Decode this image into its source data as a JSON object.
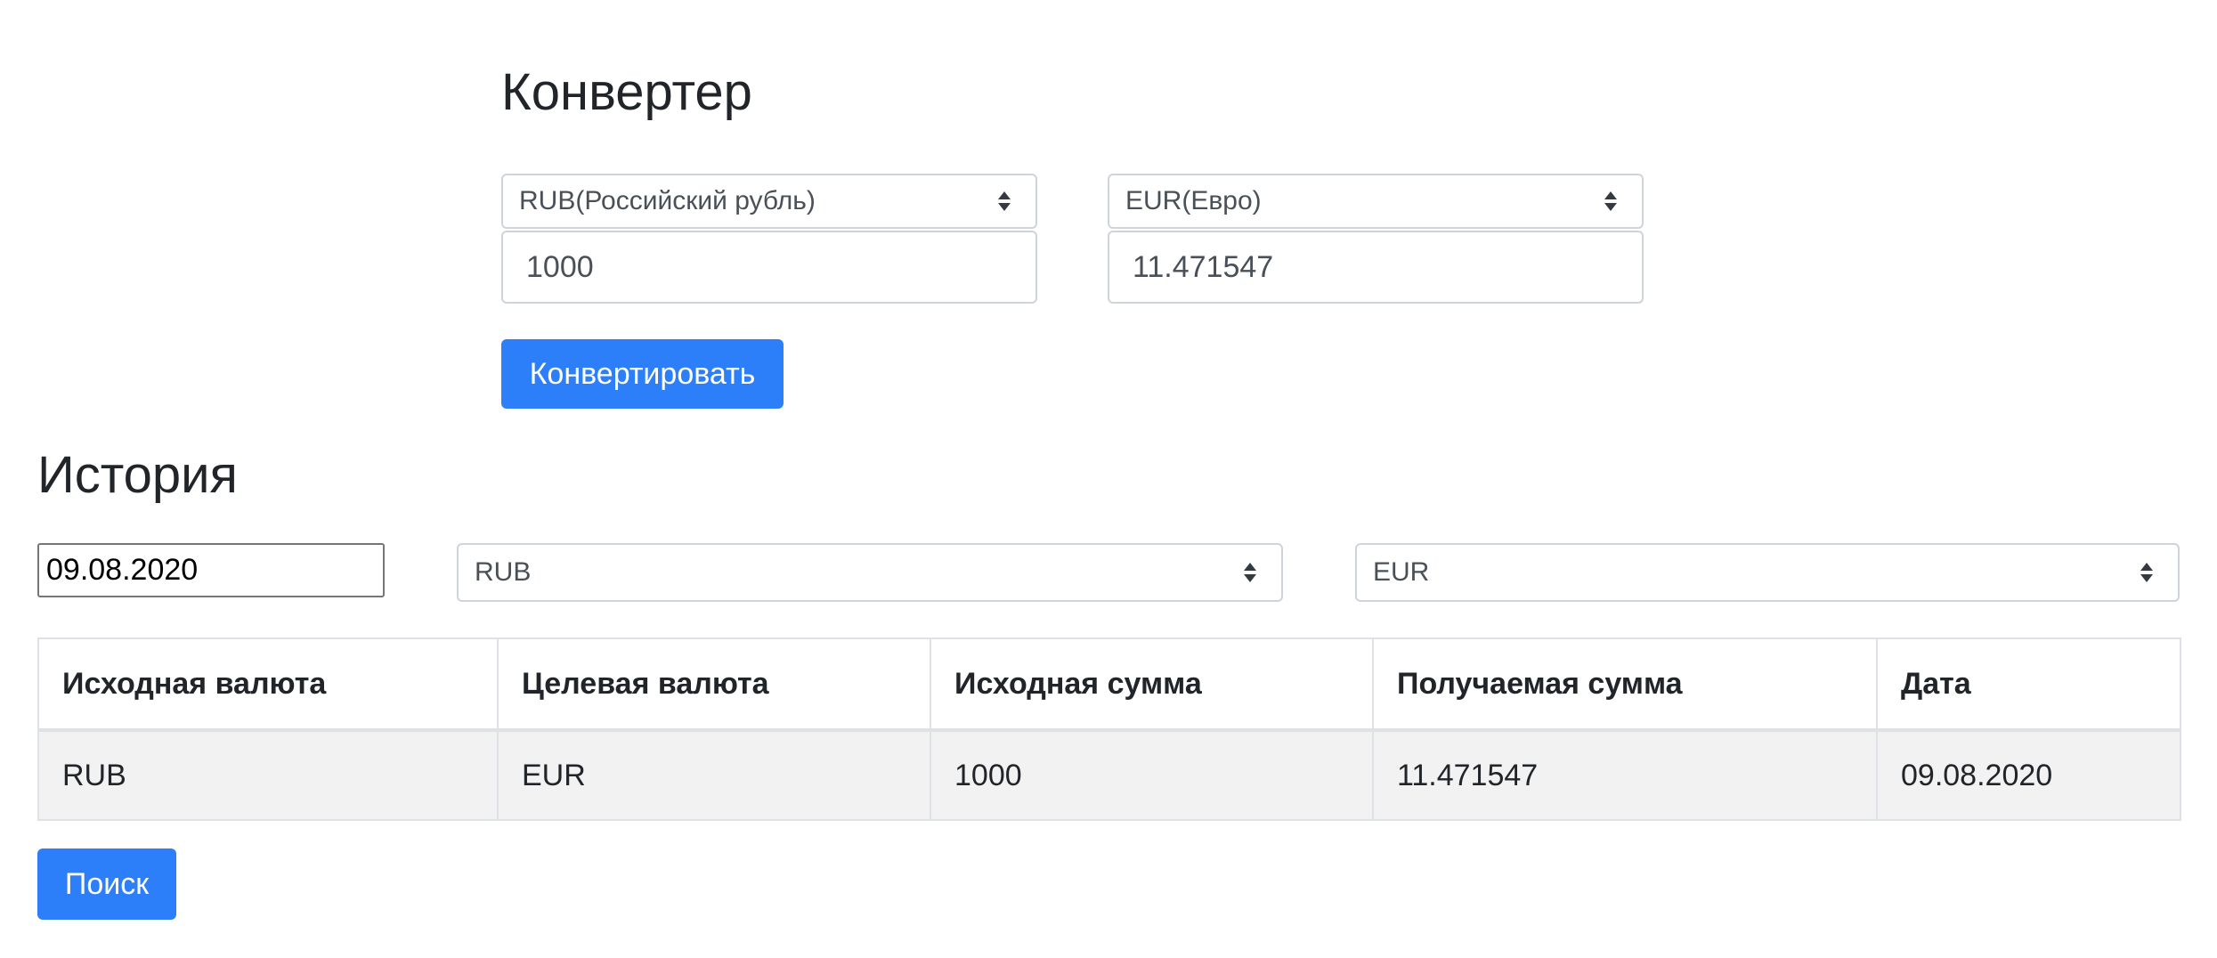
{
  "converter": {
    "title": "Конвертер",
    "from_currency": "RUB(Российский рубль)",
    "to_currency": "EUR(Евро)",
    "from_amount": "1000",
    "to_amount": "11.471547",
    "convert_label": "Конвертировать"
  },
  "history": {
    "title": "История",
    "date_value": "09.08.2020",
    "source_filter": "RUB",
    "target_filter": "EUR",
    "table": {
      "headers": [
        "Исходная валюта",
        "Целевая валюта",
        "Исходная сумма",
        "Получаемая сумма",
        "Дата"
      ],
      "rows": [
        [
          "RUB",
          "EUR",
          "1000",
          "11.471547",
          "09.08.2020"
        ]
      ]
    },
    "search_label": "Поиск"
  },
  "icons": {
    "select_caret": "sort-arrows-icon"
  },
  "colors": {
    "primary": "#2d7ff9",
    "row_background": "#f2f2f2",
    "border": "#ced4da"
  }
}
